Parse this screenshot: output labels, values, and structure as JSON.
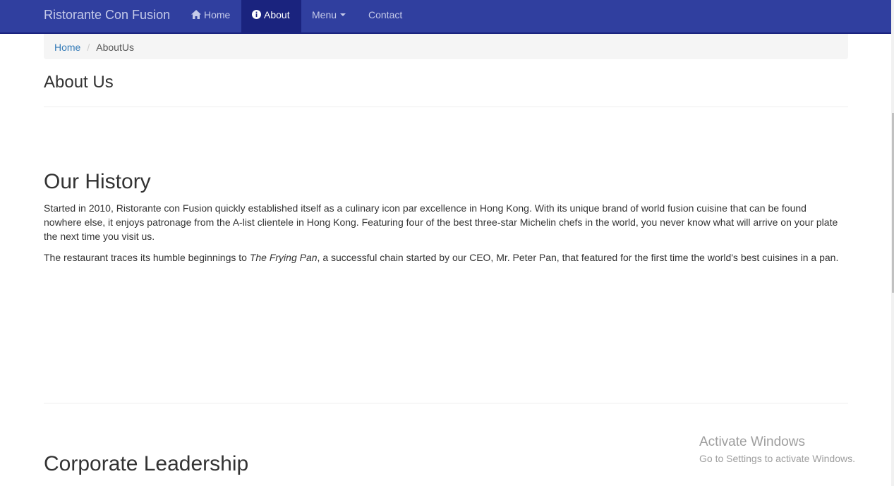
{
  "navbar": {
    "brand": "Ristorante Con Fusion",
    "items": [
      {
        "label": "Home",
        "icon": "home-icon",
        "active": false
      },
      {
        "label": "About",
        "icon": "info-circle-icon",
        "active": true
      },
      {
        "label": "Menu",
        "icon": "caret-down-icon",
        "active": false
      },
      {
        "label": "Contact",
        "active": false
      }
    ],
    "colors": {
      "background": "#303f9f",
      "active": "#1a237e",
      "text": "#c5cae9"
    }
  },
  "breadcrumb": {
    "home": "Home",
    "separator": "/",
    "current": "AboutUs"
  },
  "about": {
    "title": "About Us"
  },
  "history": {
    "title": "Our History",
    "p1": "Started in 2010, Ristorante con Fusion quickly established itself as a culinary icon par excellence in Hong Kong. With its unique brand of world fusion cuisine that can be found nowhere else, it enjoys patronage from the A-list clientele in Hong Kong. Featuring four of the best three-star Michelin chefs in the world, you never know what will arrive on your plate the next time you visit us.",
    "p2_before": "The restaurant traces its humble beginnings to ",
    "p2_em": "The Frying Pan",
    "p2_after": ", a successful chain started by our CEO, Mr. Peter Pan, that featured for the first time the world's best cuisines in a pan."
  },
  "leadership": {
    "title": "Corporate Leadership"
  },
  "watermark": {
    "line1": "Activate Windows",
    "line2": "Go to Settings to activate Windows."
  }
}
